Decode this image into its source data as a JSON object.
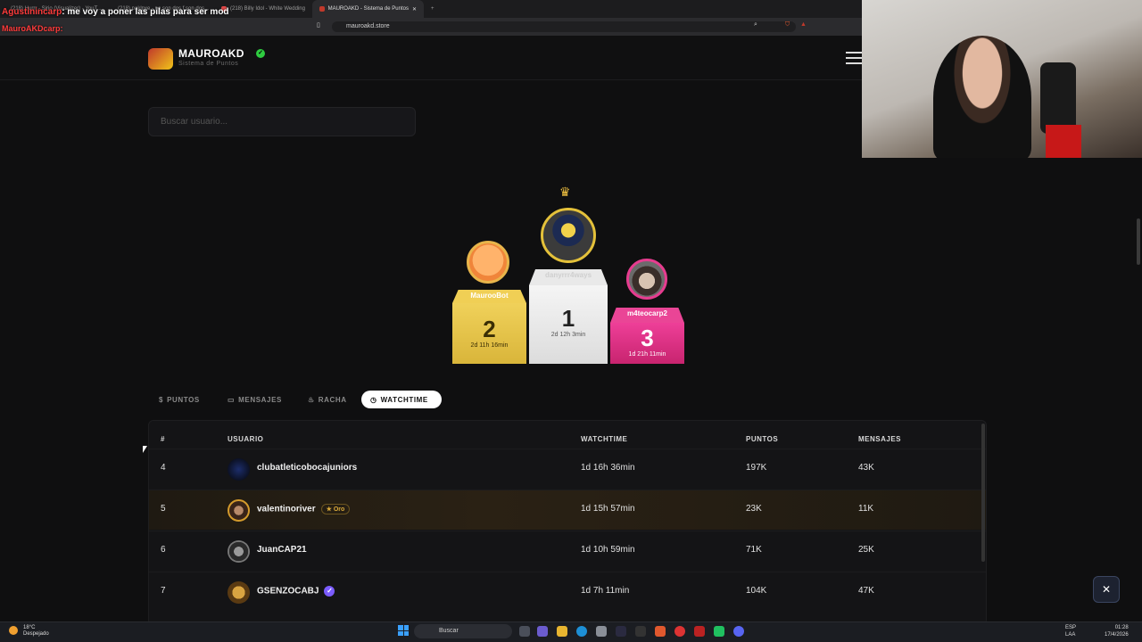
{
  "browser": {
    "tabs": [
      {
        "label": "(218) Hurrr - Sirio (Visualizer) - YouT...",
        "active": false
      },
      {
        "label": "(218) paklpxe - no son dos f son dos...",
        "active": false
      },
      {
        "label": "(218) Billy Idol - White Wedding",
        "active": false
      },
      {
        "label": "MAUROAKD - Sistema de Puntos",
        "active": true
      }
    ],
    "new_tab": "+",
    "url": "mauroakd.store"
  },
  "stream_chat": {
    "user1": "Agustinincarp",
    "message1": "me voy a poner las pilas para ser mod",
    "user2": "MauroAKDcarp"
  },
  "site": {
    "brand": "MAUROAKD",
    "subtitle": "Sistema de Puntos",
    "verified_symbol": "✓",
    "search_placeholder": "Buscar usuario..."
  },
  "podium": {
    "crown": "♛",
    "first": {
      "name": "danyrrr4ways",
      "rank": "1",
      "time": "2d 12h 3min"
    },
    "second": {
      "name": "MaurooBot",
      "rank": "2",
      "time": "2d 11h 16min"
    },
    "third": {
      "name": "m4teocarp2",
      "rank": "3",
      "time": "1d 21h 11min"
    }
  },
  "filters": {
    "puntos": "PUNTOS",
    "mensajes": "MENSAJES",
    "racha": "RACHA",
    "watchtime": "WATCHTIME",
    "active": "watchtime"
  },
  "table": {
    "headers": {
      "rank": "#",
      "user": "USUARIO",
      "watchtime": "WATCHTIME",
      "puntos": "PUNTOS",
      "mensajes": "MENSAJES"
    },
    "rows": [
      {
        "rank": "4",
        "user": "clubatleticobocajuniors",
        "watchtime": "1d 16h 36min",
        "puntos": "197K",
        "mensajes": "43K"
      },
      {
        "rank": "5",
        "user": "valentinoriver",
        "badge": "★ Oro",
        "watchtime": "1d 15h 57min",
        "puntos": "23K",
        "mensajes": "11K"
      },
      {
        "rank": "6",
        "user": "JuanCAP21",
        "watchtime": "1d 10h 59min",
        "puntos": "71K",
        "mensajes": "25K"
      },
      {
        "rank": "7",
        "user": "GSENZOCABJ",
        "verified": "✓",
        "watchtime": "1d 7h 11min",
        "puntos": "104K",
        "mensajes": "47K"
      }
    ]
  },
  "taskbar": {
    "temp": "18°C",
    "weather": "Despejado",
    "search": "Buscar",
    "lang": "ESP",
    "lang2": "LAA",
    "time": "01:28",
    "date": "17/4/2026"
  },
  "colors": {
    "gold": "#e4c13a",
    "pink": "#e63c8f",
    "accent_active": "#ffffff"
  }
}
